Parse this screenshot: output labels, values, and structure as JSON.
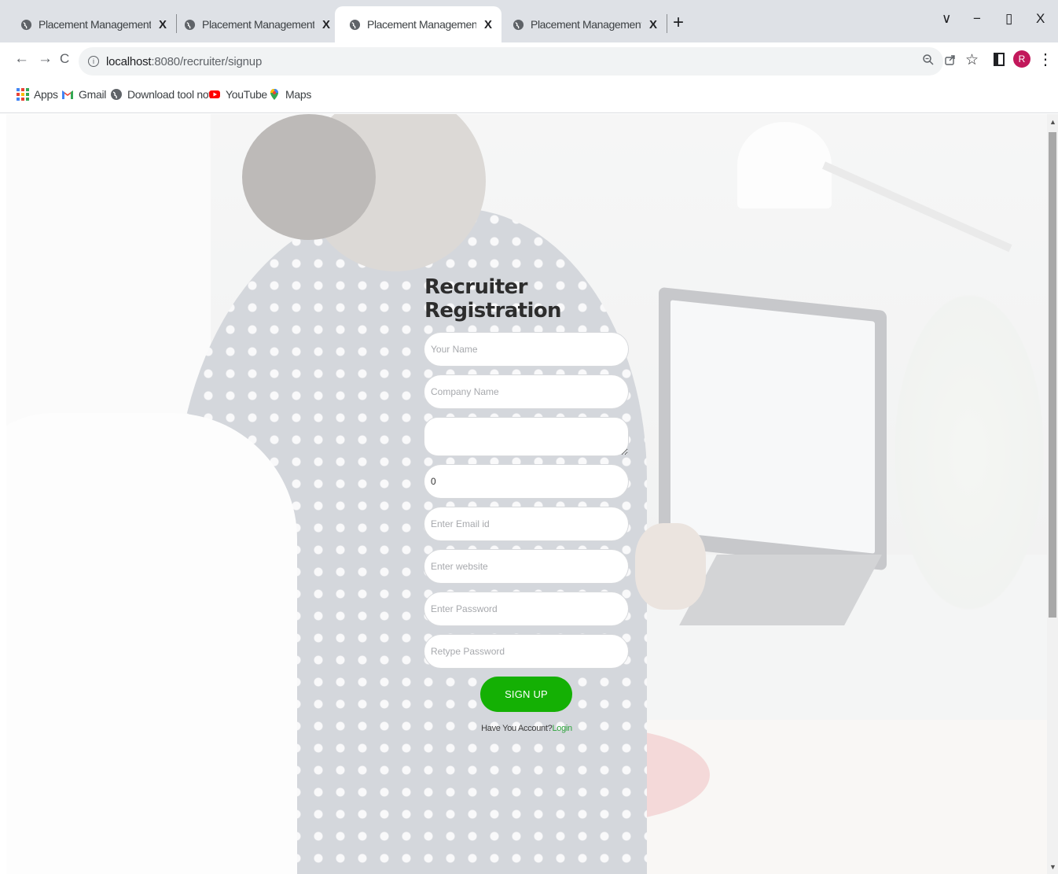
{
  "browser": {
    "tabs": [
      {
        "title": "Placement Management System",
        "close": "X",
        "active": false
      },
      {
        "title": "Placement Management System",
        "close": "X",
        "active": false
      },
      {
        "title": "Placement Management System",
        "close": "X",
        "active": true
      },
      {
        "title": "Placement Management System",
        "close": "X",
        "active": false
      }
    ],
    "new_tab": "+",
    "window_controls": {
      "tab_search": "∨",
      "minimize": "−",
      "restore": "▯",
      "close": "X"
    },
    "nav": {
      "back": "←",
      "forward": "→",
      "reload": "C"
    },
    "address": {
      "host": "localhost",
      "rest": ":8080/recruiter/signup"
    },
    "toolbar_icons": {
      "zoom": "zoom-icon",
      "share": "share-icon",
      "bookmark": "☆",
      "sidebar": "side-panel-icon",
      "menu": "⋮"
    },
    "profile_initial": "R",
    "bookmarks": [
      {
        "label": "Apps",
        "icon": "apps-grid-icon"
      },
      {
        "label": "Gmail",
        "icon": "gmail-icon"
      },
      {
        "label": "Download tool now",
        "icon": "globe-icon"
      },
      {
        "label": "YouTube",
        "icon": "youtube-icon"
      },
      {
        "label": "Maps",
        "icon": "maps-pin-icon"
      }
    ]
  },
  "form": {
    "title": "Recruiter Registration",
    "fields": {
      "name_placeholder": "Your Name",
      "company_placeholder": "Company Name",
      "address_value": "",
      "number_value": "0",
      "email_placeholder": "Enter Email id",
      "website_placeholder": "Enter website",
      "password_placeholder": "Enter Password",
      "retype_placeholder": "Retype Password"
    },
    "submit_label": "SIGN UP",
    "login_prompt": "Have You Account?",
    "login_link": "Login"
  },
  "colors": {
    "primary_button": "#14b004",
    "link": "#2ea43c",
    "profile": "#c2185b"
  }
}
